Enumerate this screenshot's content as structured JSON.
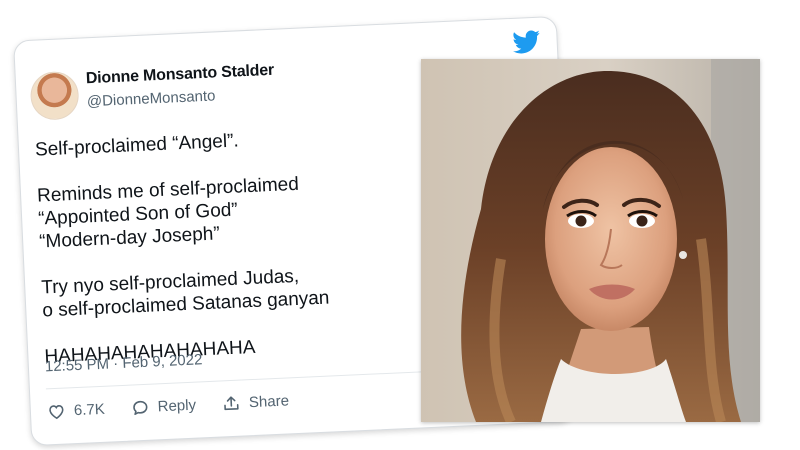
{
  "tweet": {
    "display_name": "Dionne Monsanto Stalder",
    "handle": "@DionneMonsanto",
    "lines": [
      "Self-proclaimed “Angel”.",
      "",
      "Reminds me of self-proclaimed",
      "“Appointed Son of God”",
      "“Modern-day Joseph”",
      "",
      "Try nyo self-proclaimed Judas,",
      "o self-proclaimed Satanas ganyan",
      "",
      "HAHAHAHAHAHAHAHA"
    ],
    "timestamp": "12:55 PM · Feb 9, 2022",
    "likes": "6.7K",
    "reply_label": "Reply",
    "share_label": "Share"
  },
  "icons": {
    "brand": "twitter-bird-icon",
    "like": "heart-icon",
    "reply": "speech-bubble-icon",
    "share": "share-upload-icon"
  },
  "colors": {
    "twitter_blue": "#1d9bf0",
    "secondary_text": "#536471",
    "primary_text": "#0f1419"
  }
}
